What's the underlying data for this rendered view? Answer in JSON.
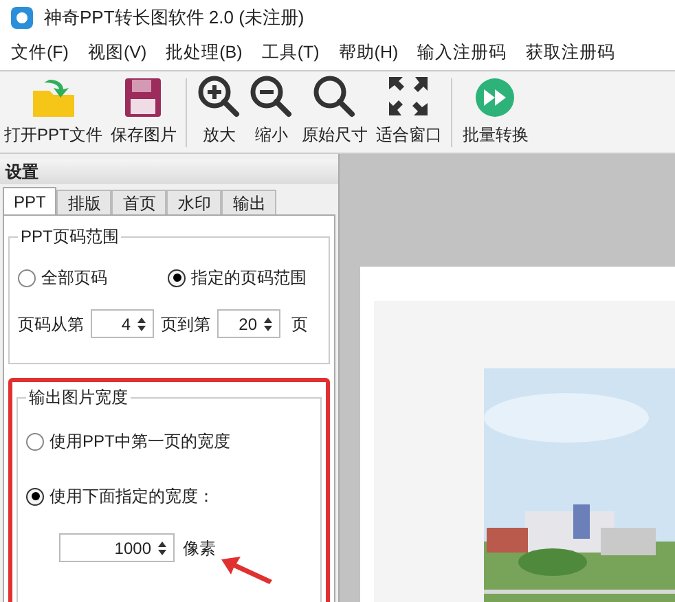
{
  "window": {
    "title": "神奇PPT转长图软件 2.0 (未注册)"
  },
  "menu": [
    "文件(F)",
    "视图(V)",
    "批处理(B)",
    "工具(T)",
    "帮助(H)",
    "输入注册码",
    "获取注册码"
  ],
  "toolbar": [
    {
      "kind": "open",
      "label": "打开PPT文件"
    },
    {
      "kind": "save",
      "label": "保存图片"
    },
    {
      "kind": "zoom_in",
      "label": "放大"
    },
    {
      "kind": "zoom_out",
      "label": "缩小"
    },
    {
      "kind": "original",
      "label": "原始尺寸"
    },
    {
      "kind": "fit",
      "label": "适合窗口"
    },
    {
      "kind": "batch",
      "label": "批量转换"
    }
  ],
  "settings": {
    "title": "设置",
    "tabs": [
      {
        "label": "PPT",
        "selected": true
      },
      {
        "label": "排版",
        "selected": false
      },
      {
        "label": "首页",
        "selected": false
      },
      {
        "label": "水印",
        "selected": false
      },
      {
        "label": "输出",
        "selected": false
      }
    ],
    "page_range": {
      "title": "PPT页码范围",
      "options": [
        {
          "label": "全部页码",
          "selected": false
        },
        {
          "label": "指定的页码范围",
          "selected": true
        }
      ],
      "from_label": "页码从第",
      "from_value": "4",
      "to_label": "页到第",
      "to_value": "20",
      "unit": "页"
    },
    "width": {
      "title": "输出图片宽度",
      "highlighted": true,
      "options": [
        {
          "label": "使用PPT中第一页的宽度",
          "selected": false
        },
        {
          "label": "使用下面指定的宽度：",
          "selected": true
        }
      ],
      "value": "1000",
      "unit": "像素"
    }
  }
}
